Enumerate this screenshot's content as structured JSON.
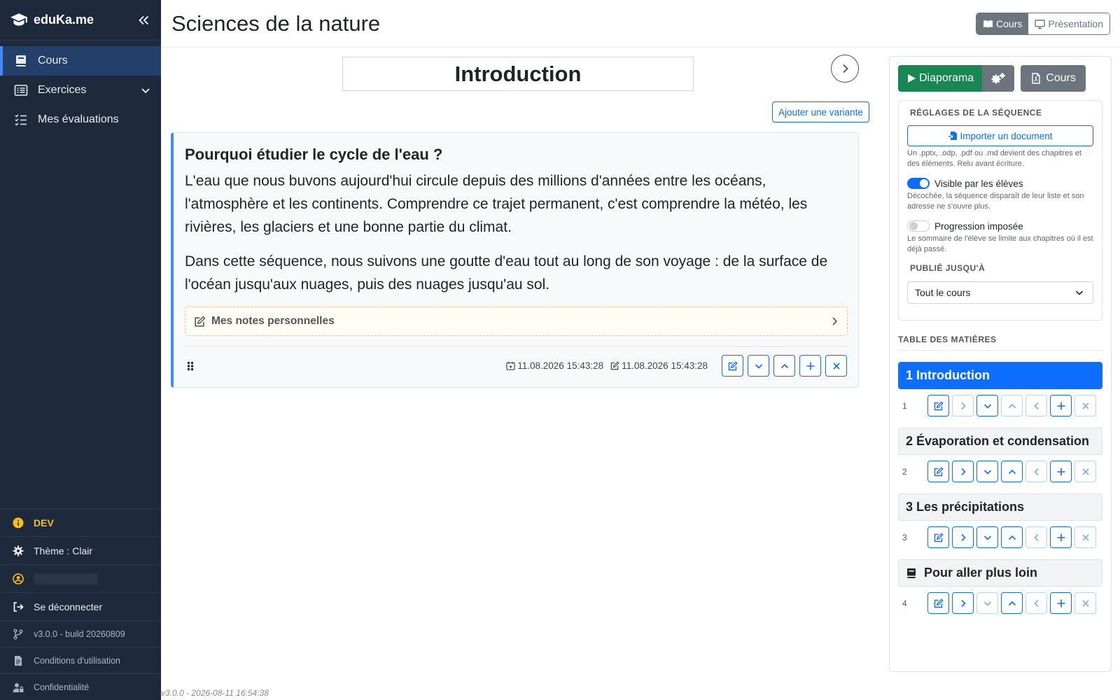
{
  "brand": {
    "name": "eduKa.me"
  },
  "sidebar": {
    "items": [
      {
        "label": "Cours"
      },
      {
        "label": "Exercices"
      },
      {
        "label": "Mes évaluations"
      }
    ],
    "bottom": {
      "env": "DEV",
      "theme": "Thème : Clair",
      "logout": "Se déconnecter",
      "version": "v3.0.0 - build 20260809",
      "terms": "Conditions d'utilisation",
      "privacy": "Confidentialité"
    }
  },
  "header": {
    "title": "Sciences de la nature",
    "mode_cours": "Cours",
    "mode_presentation": "Présentation"
  },
  "main": {
    "chapter_title": "Introduction",
    "add_variant": "Ajouter une variante",
    "card": {
      "heading": "Pourquoi étudier le cycle de l'eau ?",
      "paragraphs": [
        "L'eau que nous buvons aujourd'hui circule depuis des millions d'années entre les océans, l'atmosphère et les continents. Comprendre ce trajet permanent, c'est comprendre la météo, les rivières, les glaciers et une bonne partie du climat.",
        "Dans cette séquence, nous suivons une goutte d'eau tout au long de son voyage : de la surface de l'océan jusqu'aux nuages, puis des nuages jusqu'au sol."
      ],
      "notes": "Mes notes personnelles",
      "created": "11.08.2026 15:43:28",
      "modified": "11.08.2026 15:43:28"
    },
    "footer_version": "v3.0.0 - 2026-08-11 16:54:38"
  },
  "panel": {
    "diaporama": "Diaporama",
    "cours": "Cours",
    "settings_label": "RÉGLAGES DE LA SÉQUENCE",
    "import": "Importer un document",
    "import_help": "Un .pptx, .odp, .pdf ou .md devient des chapitres et des éléments. Relu avant écriture.",
    "visible_label": "Visible par les élèves",
    "visible_on": true,
    "visible_help": "Décochée, la séquence disparaît de leur liste et son adresse ne s'ouvre plus.",
    "progress_label": "Progression imposée",
    "progress_on": false,
    "progress_help": "Le sommaire de l'élève se limite aux chapitres où il est déjà passé.",
    "published_label": "PUBLIÉ JUSQU'À",
    "published_value": "Tout le cours",
    "toc_label": "TABLE DES MATIÈRES",
    "toc": [
      {
        "label": "1 Introduction",
        "num": "1"
      },
      {
        "label": "2 Évaporation et condensation",
        "num": "2"
      },
      {
        "label": "3 Les précipitations",
        "num": "3"
      },
      {
        "label": "Pour aller plus loin",
        "num": "4",
        "icon": "book-icon"
      }
    ]
  },
  "colors": {
    "sidebar": "#1e2a3b",
    "accent": "#0d6efd",
    "success": "#198754",
    "secondary": "#6c757d",
    "dev": "#ffc107"
  }
}
